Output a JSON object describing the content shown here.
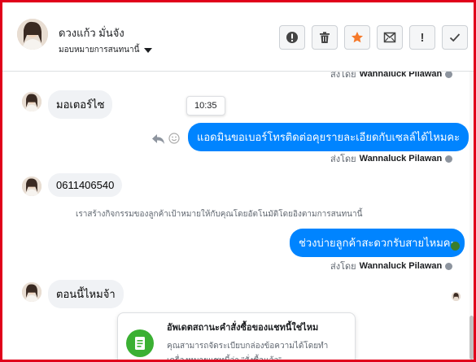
{
  "header": {
    "contact_name": "ดวงแก้ว มั่นจัง",
    "assign_label": "มอบหมายการสนทนานี้",
    "actions": [
      {
        "name": "mark-spam",
        "icon": "exclamation-circle-icon"
      },
      {
        "name": "delete",
        "icon": "trash-icon"
      },
      {
        "name": "star",
        "icon": "star-icon"
      },
      {
        "name": "mark-unread",
        "icon": "envelope-icon"
      },
      {
        "name": "follow-up",
        "icon": "exclamation-icon"
      },
      {
        "name": "mark-done",
        "icon": "check-icon"
      }
    ]
  },
  "conversation": {
    "sent_by_prefix": "ส่งโดย",
    "sender_name": "Wannaluck Pilawan",
    "tooltip_time": "10:35",
    "messages": [
      {
        "direction": "in",
        "text": "มอเตอร์ไซ"
      },
      {
        "direction": "out",
        "text": "แอดมินขอเบอร์โทรติดต่อคุยรายละเอียดกับเซลล์ได้ไหมคะ"
      },
      {
        "direction": "in",
        "text": "0611406540"
      },
      {
        "direction": "out",
        "text": "ช่วงบ่ายลูกค้าสะดวกรับสายไหมคะ"
      },
      {
        "direction": "in",
        "text": "ตอนนี้ไหมจ้า"
      }
    ],
    "system_message": "เราสร้างกิจกรรมของลูกค้าเป้าหมายให้กับคุณโดยอัตโนมัติโดยอิงตามการสนทนานี้"
  },
  "card": {
    "icon": "order-note-icon",
    "title": "อัพเดตสถานะคำสั่งซื้อของแชทนี้ใช่ไหม",
    "desc_line1": "คุณสามารถจัดระเบียบกล่องข้อความได้โดยทำ",
    "desc_line2": "เครื่องหมายแชทนี้ว่า \"สั่งซื้อแล้ว\""
  },
  "colors": {
    "frame_border": "#e0001b",
    "bubble_out": "#0084ff",
    "bubble_in": "#f0f2f5",
    "star": "#f5792a",
    "card_icon_bg": "#3bb033"
  }
}
